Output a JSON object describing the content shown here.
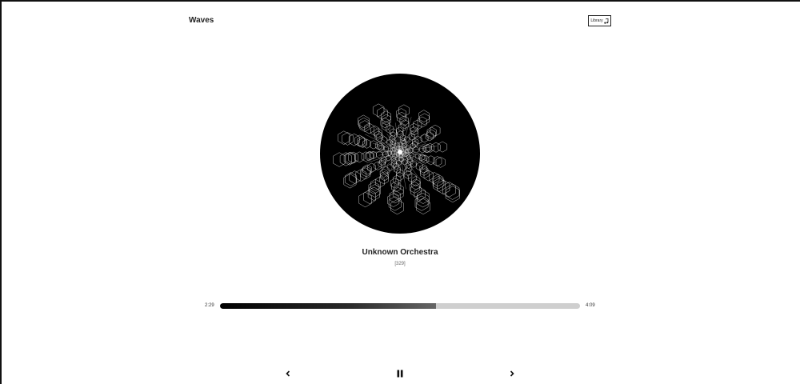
{
  "app": {
    "title": "Waves"
  },
  "header": {
    "library_label": "Library",
    "library_icon": "music-note-icon"
  },
  "track": {
    "title": "Unknown Orchestra",
    "subtitle": "[329]"
  },
  "player": {
    "current_time": "2:29",
    "total_time": "4:09",
    "progress": 0.6
  },
  "controls": {
    "prev_icon": "chevron-left-icon",
    "pause_icon": "pause-icon",
    "next_icon": "chevron-right-icon"
  }
}
